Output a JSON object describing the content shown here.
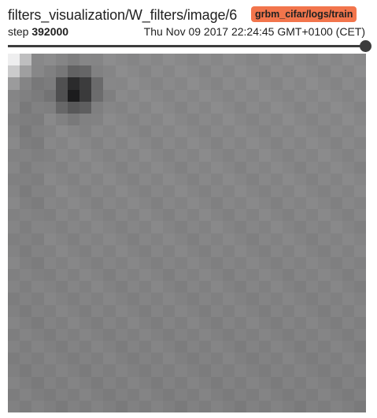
{
  "card": {
    "tag": "filters_visualization/W_filters/image/6",
    "run": "grbm_cifar/logs/train",
    "step_label": "step",
    "step_value": "392000",
    "timestamp": "Thu Nov 09 2017 22:24:45 GMT+0100 (CET)"
  },
  "slider": {
    "position_fraction": 1.0
  },
  "filter_image": {
    "description_grid_size": 30,
    "icon": "grayscale-filter-image"
  },
  "colors": {
    "run_badge": "#f2754c",
    "slider": "#3c3c3c",
    "image_base": "#8a8a8a"
  }
}
